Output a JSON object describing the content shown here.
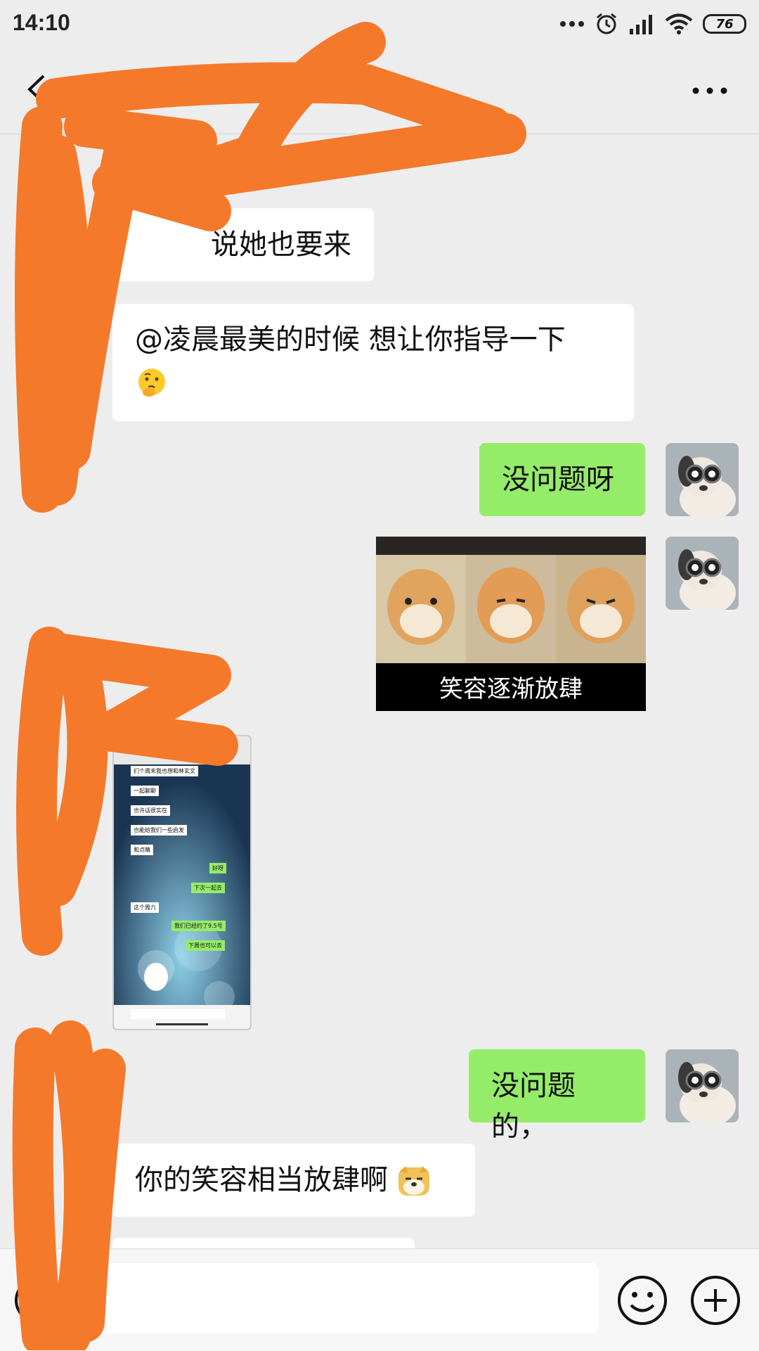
{
  "status_bar": {
    "time": "14:10",
    "battery": "76",
    "icons": [
      "more-dots-icon",
      "alarm-icon",
      "signal-icon",
      "wifi-icon",
      "battery-icon"
    ]
  },
  "header": {
    "title": "",
    "back_icon": "chevron-left-icon",
    "more_icon": "more-horizontal-icon"
  },
  "messages": {
    "m1": "说她也要来",
    "m2_line1": "@凌晨最美的时候  想让你指导一下",
    "m2_emoji": "thinking-face-emoji",
    "m3": "没问题呀",
    "sticker_caption": "笑容逐渐放肆",
    "m4": "没问题的，",
    "m5": "你的笑容相当放肆啊",
    "m5_emoji": "doge-emoji"
  },
  "screenshot_preview": {
    "bubbles": [
      "们个周末我也想和林玄文",
      "一起聊聊",
      "也许话很实在",
      "也能给我们一些启发",
      "和点睛",
      "好呀",
      "下次一起去",
      "这个周六",
      "我们已经约了9.5号",
      "下周也可以去"
    ]
  },
  "bottom_bar": {
    "input_value": "",
    "icons": [
      "voice-icon",
      "emoji-icon",
      "plus-icon"
    ]
  },
  "colors": {
    "background": "#ededed",
    "bubble_received": "#ffffff",
    "bubble_sent": "#95ec69",
    "redaction": "#f5792a"
  }
}
